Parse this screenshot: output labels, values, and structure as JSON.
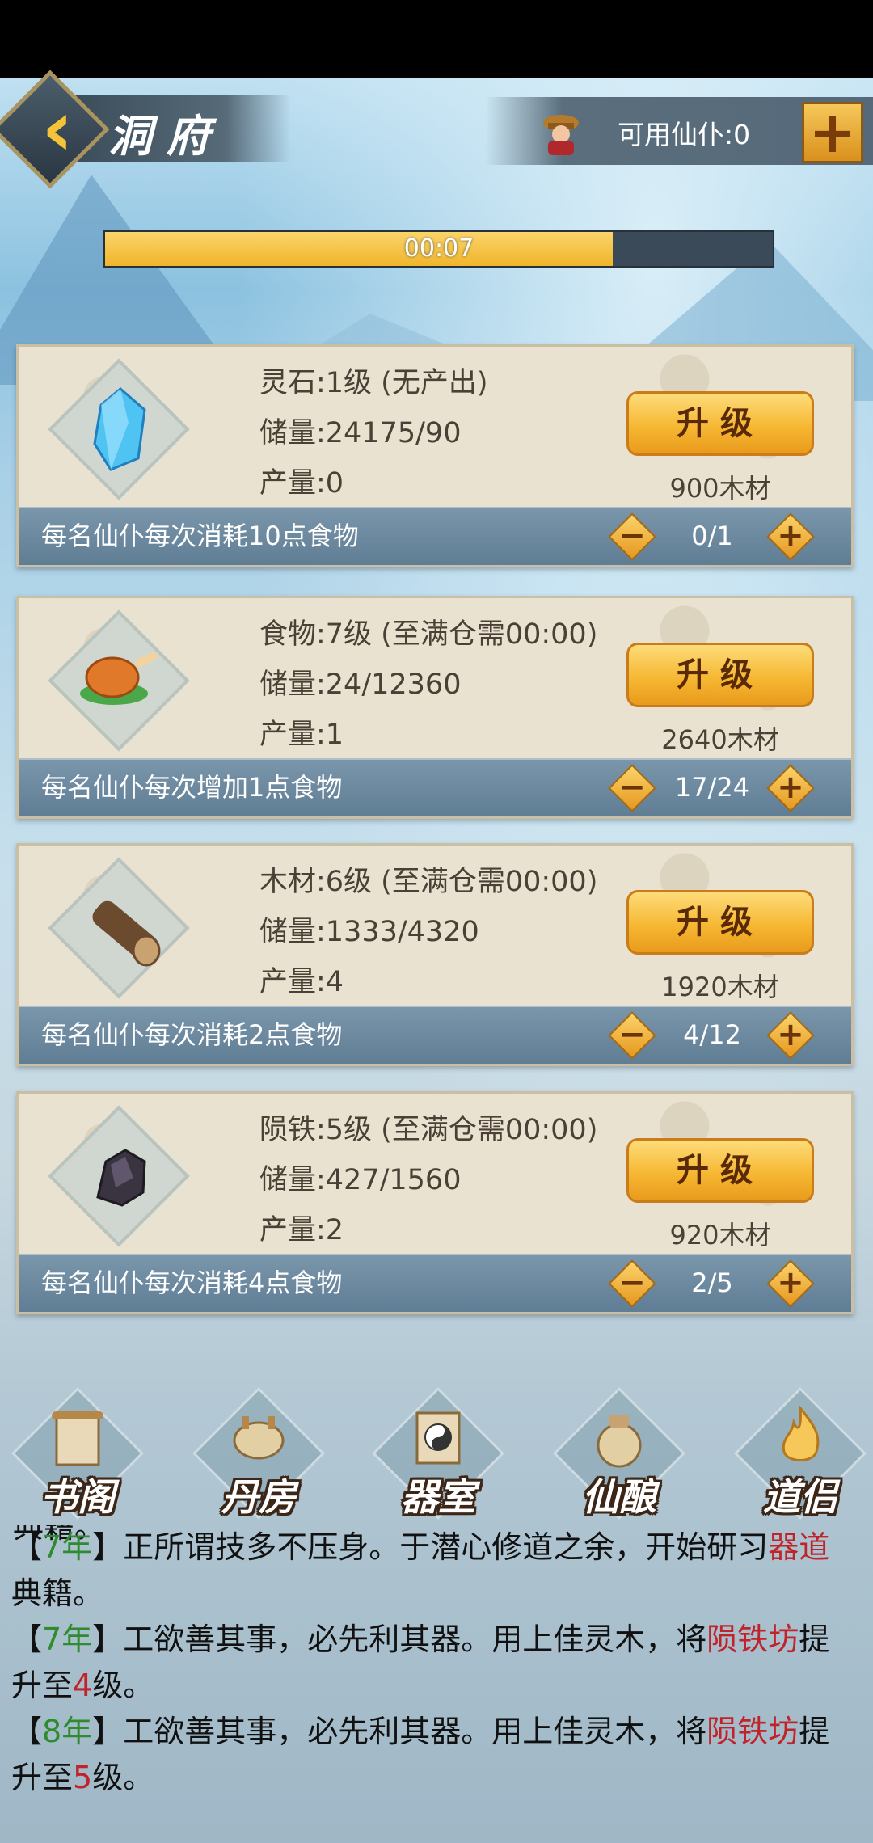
{
  "header": {
    "title": "洞府",
    "servants_label": "可用仙仆:0",
    "add_label": "+"
  },
  "progress": {
    "time": "00:07",
    "fraction": 0.76
  },
  "resources": [
    {
      "name_line": "灵石:1级 (无产出)",
      "storage": "储量:24175/90",
      "output": "产量:0",
      "upgrade": "升级",
      "cost": "900木材",
      "note": "每名仙仆每次消耗10点食物",
      "count": "0/1",
      "icon": "crystal-icon"
    },
    {
      "name_line": "食物:7级 (至满仓需00:00)",
      "storage": "储量:24/12360",
      "output": "产量:1",
      "upgrade": "升级",
      "cost": "2640木材",
      "note": "每名仙仆每次增加1点食物",
      "count": "17/24",
      "icon": "roast-chicken-icon"
    },
    {
      "name_line": "木材:6级 (至满仓需00:00)",
      "storage": "储量:1333/4320",
      "output": "产量:4",
      "upgrade": "升级",
      "cost": "1920木材",
      "note": "每名仙仆每次消耗2点食物",
      "count": "4/12",
      "icon": "log-icon"
    },
    {
      "name_line": "陨铁:5级 (至满仓需00:00)",
      "storage": "储量:427/1560",
      "output": "产量:2",
      "upgrade": "升级",
      "cost": "920木材",
      "note": "每名仙仆每次消耗4点食物",
      "count": "2/5",
      "icon": "meteorite-icon"
    }
  ],
  "nav": [
    {
      "label": "书阁",
      "icon": "scroll-icon"
    },
    {
      "label": "丹房",
      "icon": "cauldron-icon"
    },
    {
      "label": "器室",
      "icon": "yinyang-banner-icon"
    },
    {
      "label": "仙酿",
      "icon": "wine-jar-icon"
    },
    {
      "label": "道侣",
      "icon": "flame-icon"
    }
  ],
  "log": {
    "cut_text": "典籍。",
    "entries": [
      {
        "open": "【",
        "year": "7年",
        "close": "】",
        "text1": "正所谓技多不压身。于潜心修道之余，开始研习",
        "red1": "器道",
        "text2": "",
        "red2": "",
        "text3": "",
        "line2": "典籍。"
      },
      {
        "open": "【",
        "year": "7年",
        "close": "】",
        "text1": "工欲善其事，必先利其器。用上佳灵木，将",
        "red1": "陨铁坊",
        "text2": "提",
        "red2": "4",
        "text3": "级。",
        "line2": "升至"
      },
      {
        "open": "【",
        "year": "8年",
        "close": "】",
        "text1": "工欲善其事，必先利其器。用上佳灵木，将",
        "red1": "陨铁坊",
        "text2": "提",
        "red2": "5",
        "text3": "级。",
        "line2": "升至"
      }
    ]
  },
  "colors": {
    "accent": "#f0b52b",
    "bar": "#5f7d94",
    "year": "#2e8b2e",
    "highlight": "#c0232a"
  }
}
